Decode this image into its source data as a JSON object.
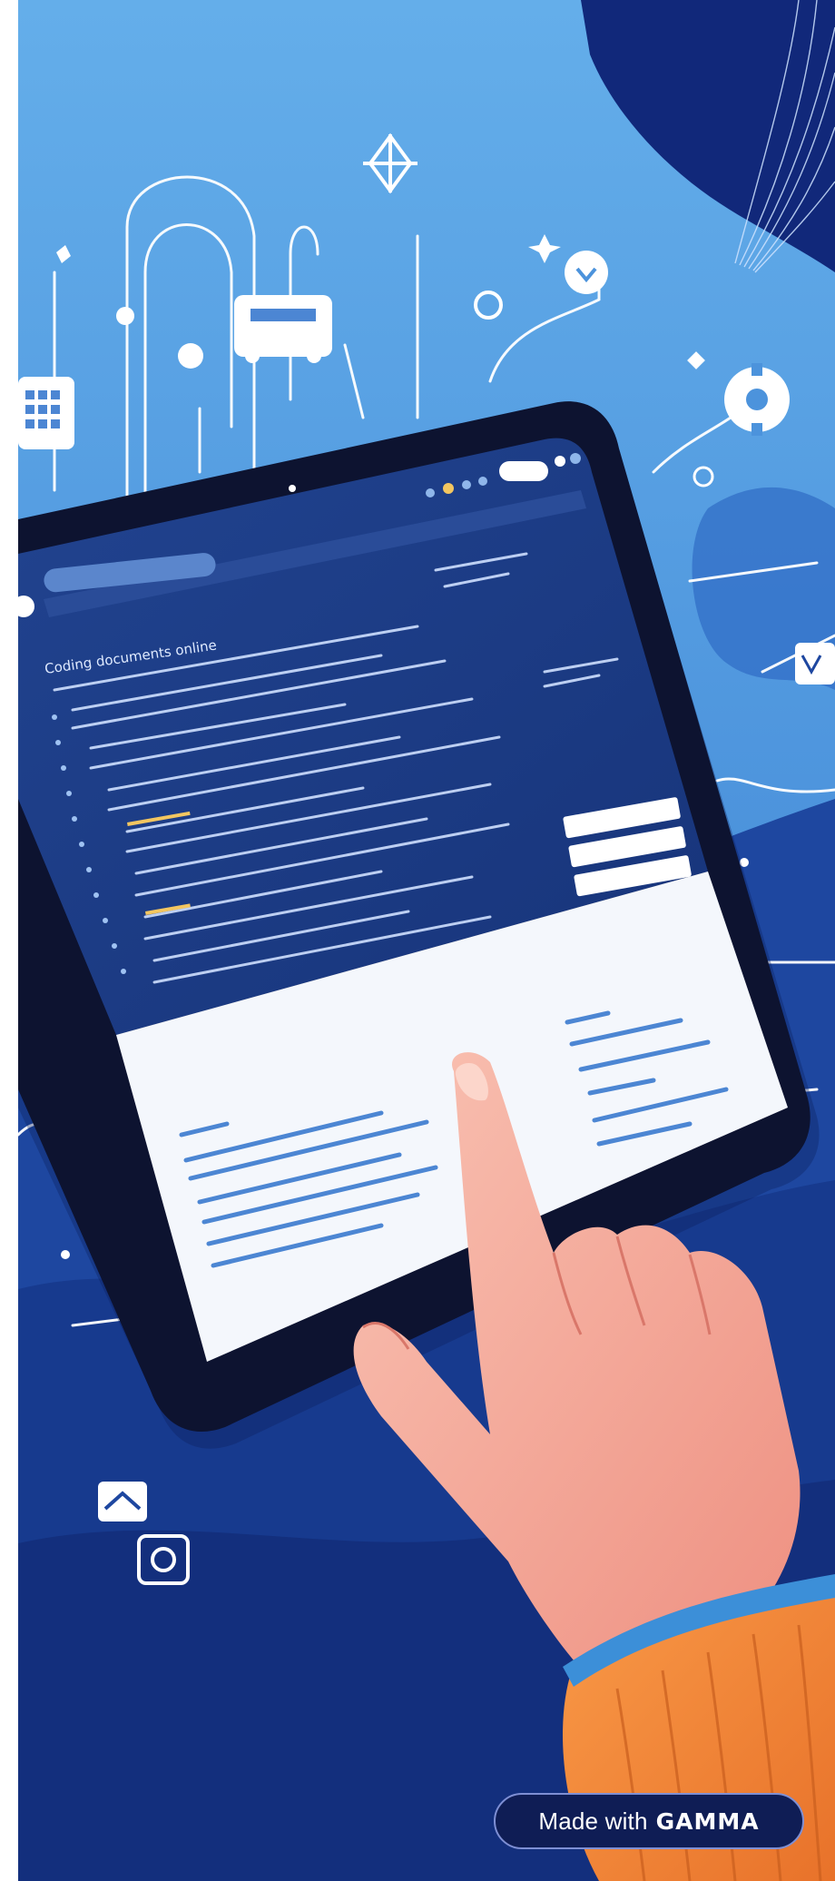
{
  "badge": {
    "prefix": "Made with",
    "brand": "GAMMA"
  },
  "tablet": {
    "screen_heading": "Coding documents online"
  },
  "colors": {
    "sky": "#5da3e2",
    "deep_blue": "#1b3a86",
    "navy": "#0f1d55",
    "tablet_bezel": "#0d1330",
    "screen_blue": "#1f3f8a",
    "paper": "#f5f8fd",
    "skin": "#f4a594",
    "sleeve": "#f58b3c",
    "cuff": "#3c8fd8"
  },
  "icons": [
    "calendar-icon",
    "car-icon",
    "target-icon",
    "star-icon",
    "gear-icon",
    "arrow-down-circle-icon",
    "lock-icon",
    "chart-icon",
    "camera-icon"
  ]
}
